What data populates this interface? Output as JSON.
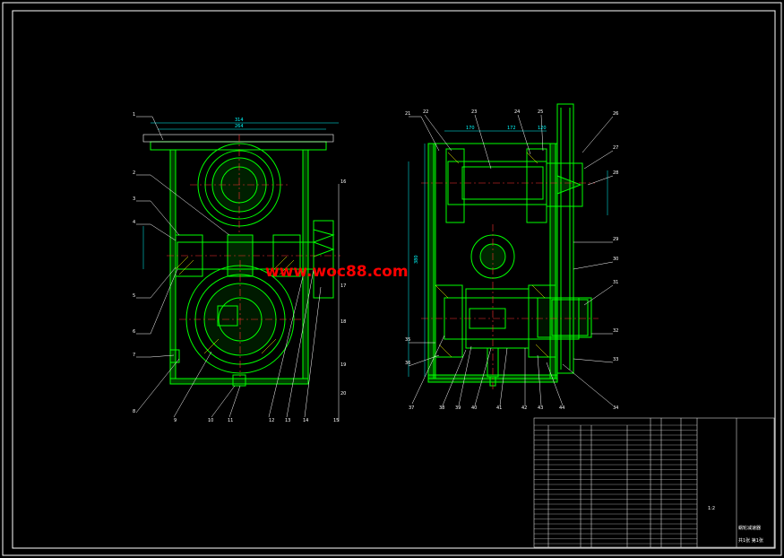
{
  "colors": {
    "background": "#000000",
    "frame": "#ffffff",
    "geometry": "#00ff00",
    "dim": "#00ffff",
    "center": "#ff3333",
    "leader": "#ffffff",
    "hatch": "#ffff00",
    "watermark": "#ff0000"
  },
  "watermark": "www.woc88.com",
  "left_view": {
    "top_dim_outer": "314",
    "top_dim_inner": "264",
    "side_callouts": [
      "1",
      "2",
      "3",
      "4",
      "5",
      "6",
      "7",
      "8"
    ],
    "bottom_callouts": [
      "9",
      "10",
      "11",
      "12",
      "13",
      "14",
      "15"
    ],
    "right_callouts": [
      "16",
      "17",
      "18",
      "19",
      "20"
    ]
  },
  "right_view": {
    "top_dims": [
      "170",
      "172",
      "120"
    ],
    "left_dim": "380",
    "top_callouts": [
      "21",
      "22",
      "23",
      "24",
      "25",
      "26",
      "27"
    ],
    "right_callouts": [
      "28",
      "29",
      "30",
      "31",
      "32",
      "33",
      "34"
    ],
    "bottom_callouts": [
      "35",
      "36",
      "37",
      "38",
      "39",
      "40",
      "41",
      "42",
      "43",
      "44"
    ]
  },
  "title_block": {
    "title": "蜗轮减速器",
    "scale": "1:2",
    "sheet": "共1张 第1张"
  }
}
